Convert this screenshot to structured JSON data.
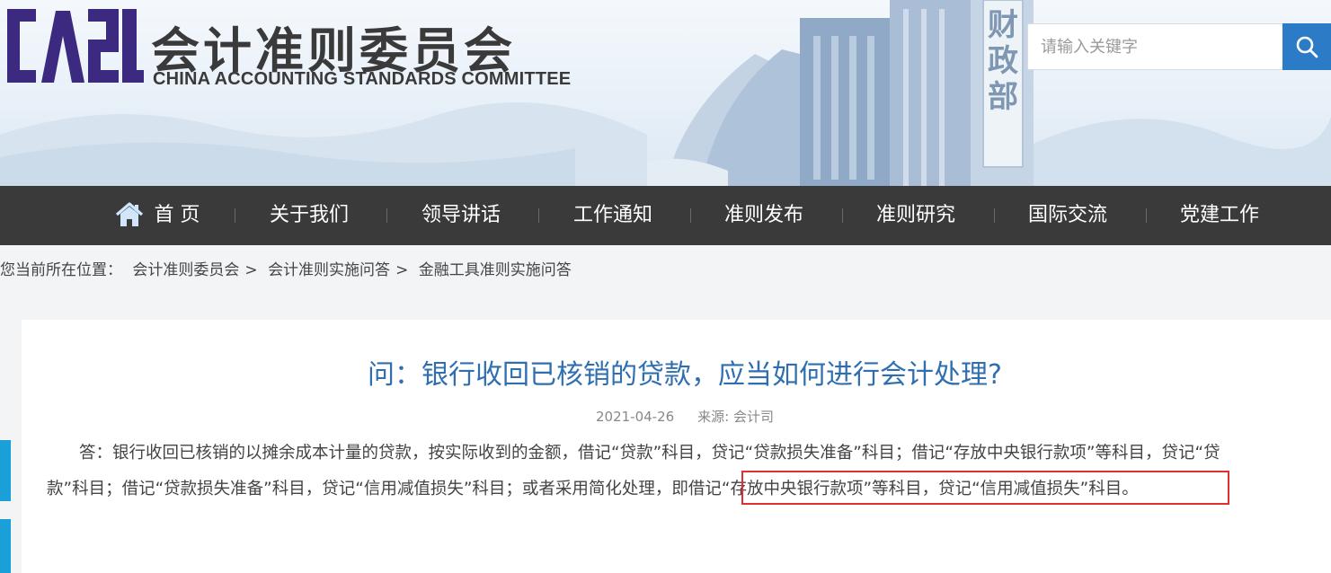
{
  "header": {
    "logo_text": "CASC",
    "site_title": "会计准则委员会",
    "site_subtitle": "CHINA ACCOUNTING STANDARDS COMMITTEE",
    "building_sign": "财政部",
    "search": {
      "placeholder": "请输入关键字",
      "icon": "search-icon"
    }
  },
  "nav": {
    "items": [
      {
        "label": "首 页",
        "icon": "home-icon"
      },
      {
        "label": "关于我们"
      },
      {
        "label": "领导讲话"
      },
      {
        "label": "工作通知"
      },
      {
        "label": "准则发布"
      },
      {
        "label": "准则研究"
      },
      {
        "label": "国际交流"
      },
      {
        "label": "党建工作"
      }
    ]
  },
  "breadcrumb": {
    "prefix": "您当前所在位置：",
    "items": [
      "会计准则委员会",
      "会计准则实施问答",
      "金融工具准则实施问答"
    ],
    "separator": ">"
  },
  "article": {
    "title": "问：银行收回已核销的贷款，应当如何进行会计处理?",
    "date": "2021-04-26",
    "source": "来源: 会计司",
    "body_line1": "答：银行收回已核销的以摊余成本计量的贷款，按实际收到的金额，借记“贷款”科目，贷记“贷款损失准备”科目；借记“存放中央银行款项”等科目，贷记“贷",
    "body_line2": "款”科目；借记“贷款损失准备”科目，贷记“信用减值损失”科目；或者采用简化处理，即借记“存放中央银行款项”等科目，贷记“信用减值损失”科目。"
  },
  "colors": {
    "nav_bg": "#3a3a3a",
    "title_blue": "#2f6fb0",
    "search_button": "#2b7bc6",
    "side_tab": "#1a9fd8",
    "highlight": "#e0312f",
    "logo_purple": "#3b2a80"
  }
}
